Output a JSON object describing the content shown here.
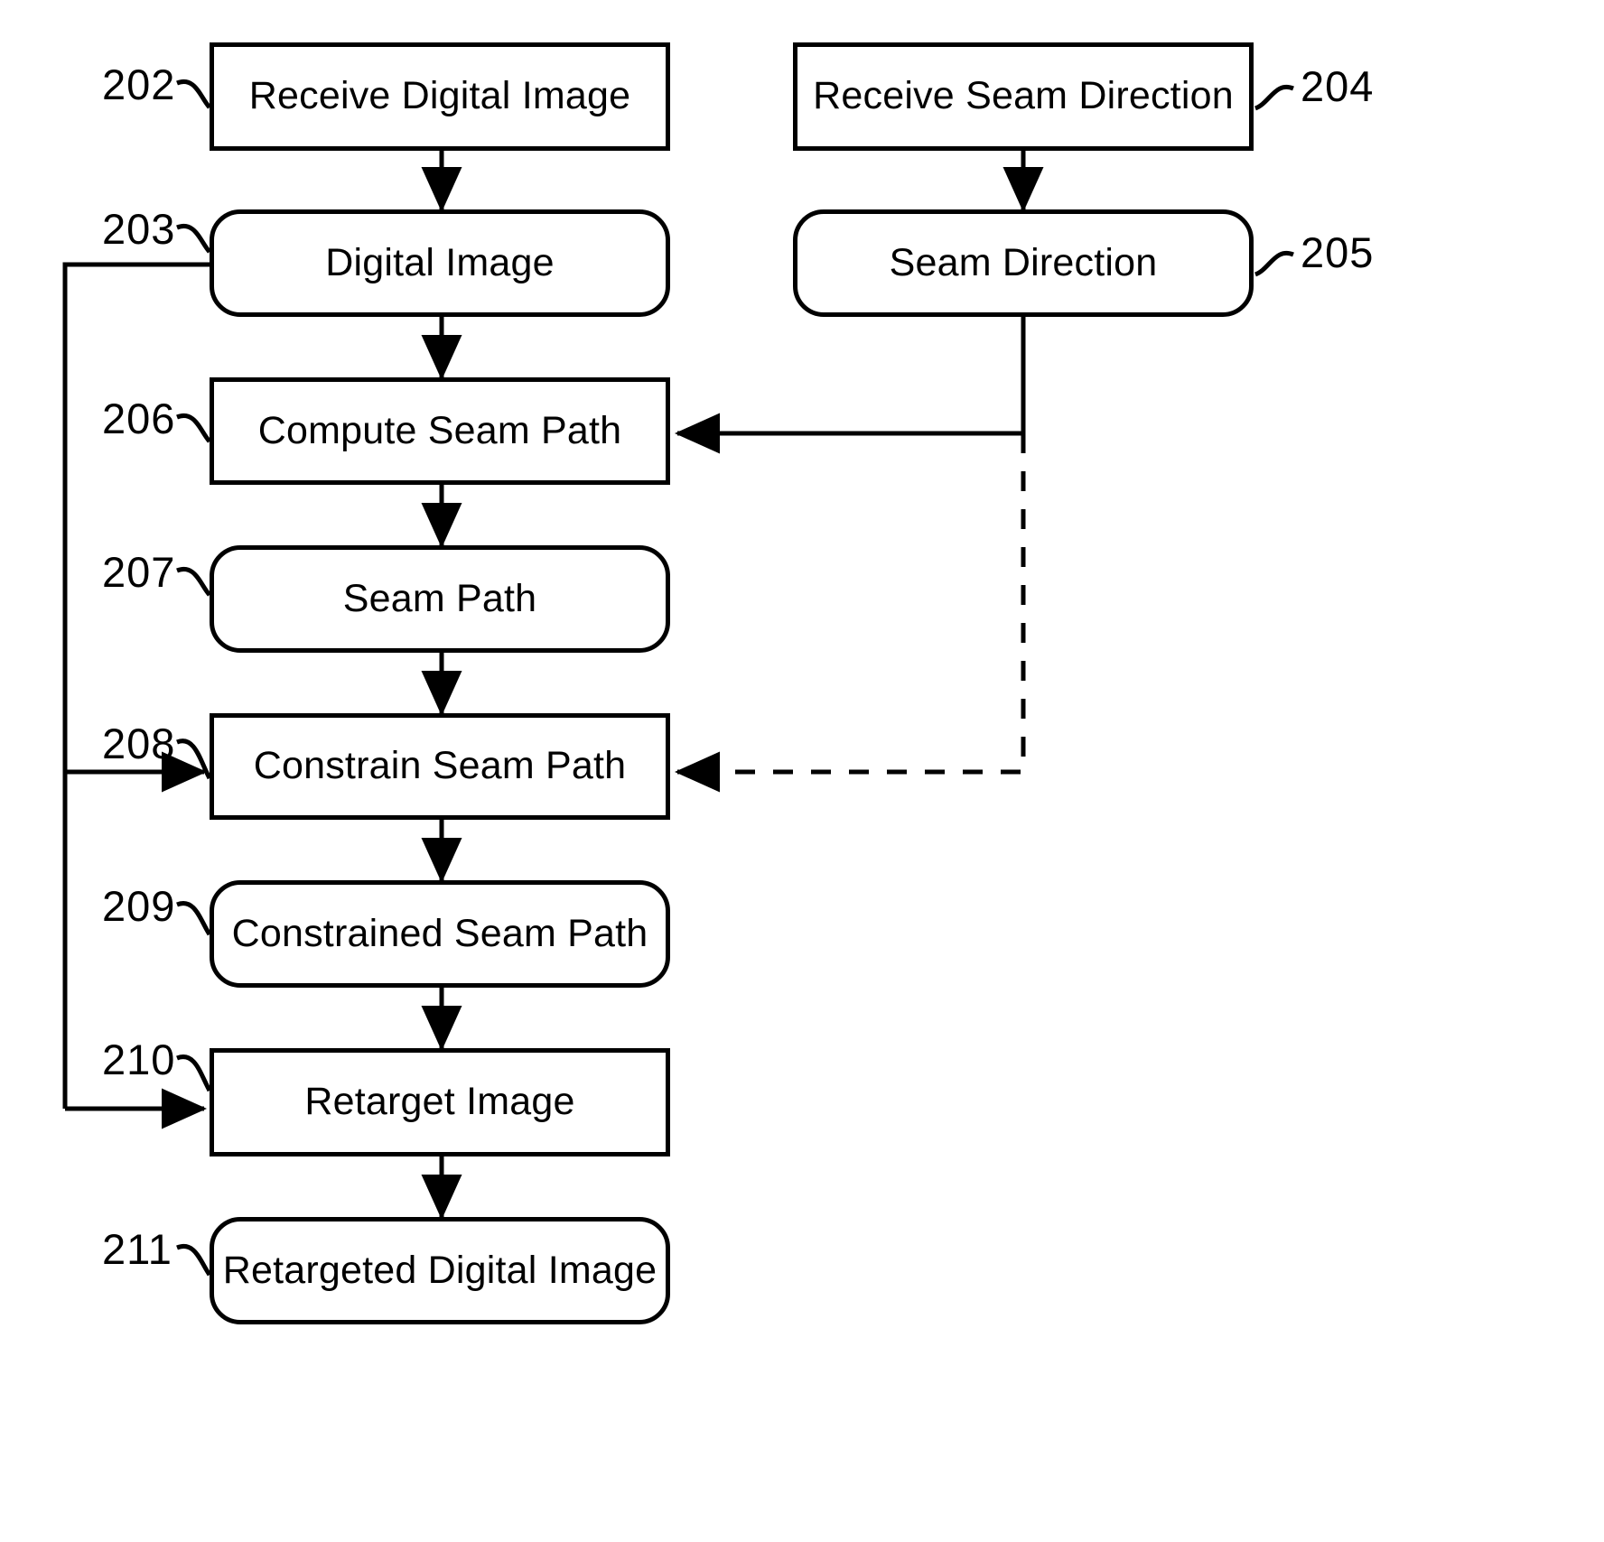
{
  "figure": {
    "type": "patent-flowchart",
    "title": "",
    "background_color": "#ffffff",
    "line_color": "#000000"
  },
  "nodes": [
    {
      "id": "202",
      "ref": "202",
      "label": "Receive Digital Image",
      "shape": "rectangle",
      "column": "left"
    },
    {
      "id": "203",
      "ref": "203",
      "label": "Digital Image",
      "shape": "rounded",
      "column": "left"
    },
    {
      "id": "204",
      "ref": "204",
      "label": "Receive Seam Direction",
      "shape": "rectangle",
      "column": "right"
    },
    {
      "id": "205",
      "ref": "205",
      "label": "Seam Direction",
      "shape": "rounded",
      "column": "right"
    },
    {
      "id": "206",
      "ref": "206",
      "label": "Compute Seam Path",
      "shape": "rectangle",
      "column": "left"
    },
    {
      "id": "207",
      "ref": "207",
      "label": "Seam Path",
      "shape": "rounded",
      "column": "left"
    },
    {
      "id": "208",
      "ref": "208",
      "label": "Constrain Seam Path",
      "shape": "rectangle",
      "column": "left"
    },
    {
      "id": "209",
      "ref": "209",
      "label": "Constrained Seam Path",
      "shape": "rounded",
      "column": "left"
    },
    {
      "id": "210",
      "ref": "210",
      "label": "Retarget Image",
      "shape": "rectangle",
      "column": "left"
    },
    {
      "id": "211",
      "ref": "211",
      "label": "Retargeted Digital Image",
      "shape": "rounded",
      "column": "left"
    }
  ],
  "edges": [
    {
      "from": "202",
      "to": "203",
      "style": "solid",
      "arrow": "down"
    },
    {
      "from": "203",
      "to": "206",
      "style": "solid",
      "arrow": "down"
    },
    {
      "from": "204",
      "to": "205",
      "style": "solid",
      "arrow": "down"
    },
    {
      "from": "205",
      "to": "206",
      "style": "solid",
      "arrow": "left"
    },
    {
      "from": "205",
      "to": "208",
      "style": "dashed",
      "arrow": "left"
    },
    {
      "from": "206",
      "to": "207",
      "style": "solid",
      "arrow": "down"
    },
    {
      "from": "207",
      "to": "208",
      "style": "solid",
      "arrow": "down"
    },
    {
      "from": "203",
      "to": "208",
      "style": "solid",
      "arrow": "right"
    },
    {
      "from": "208",
      "to": "209",
      "style": "solid",
      "arrow": "down"
    },
    {
      "from": "209",
      "to": "210",
      "style": "solid",
      "arrow": "down"
    },
    {
      "from": "203",
      "to": "210",
      "style": "solid",
      "arrow": "right"
    },
    {
      "from": "210",
      "to": "211",
      "style": "solid",
      "arrow": "down"
    }
  ]
}
